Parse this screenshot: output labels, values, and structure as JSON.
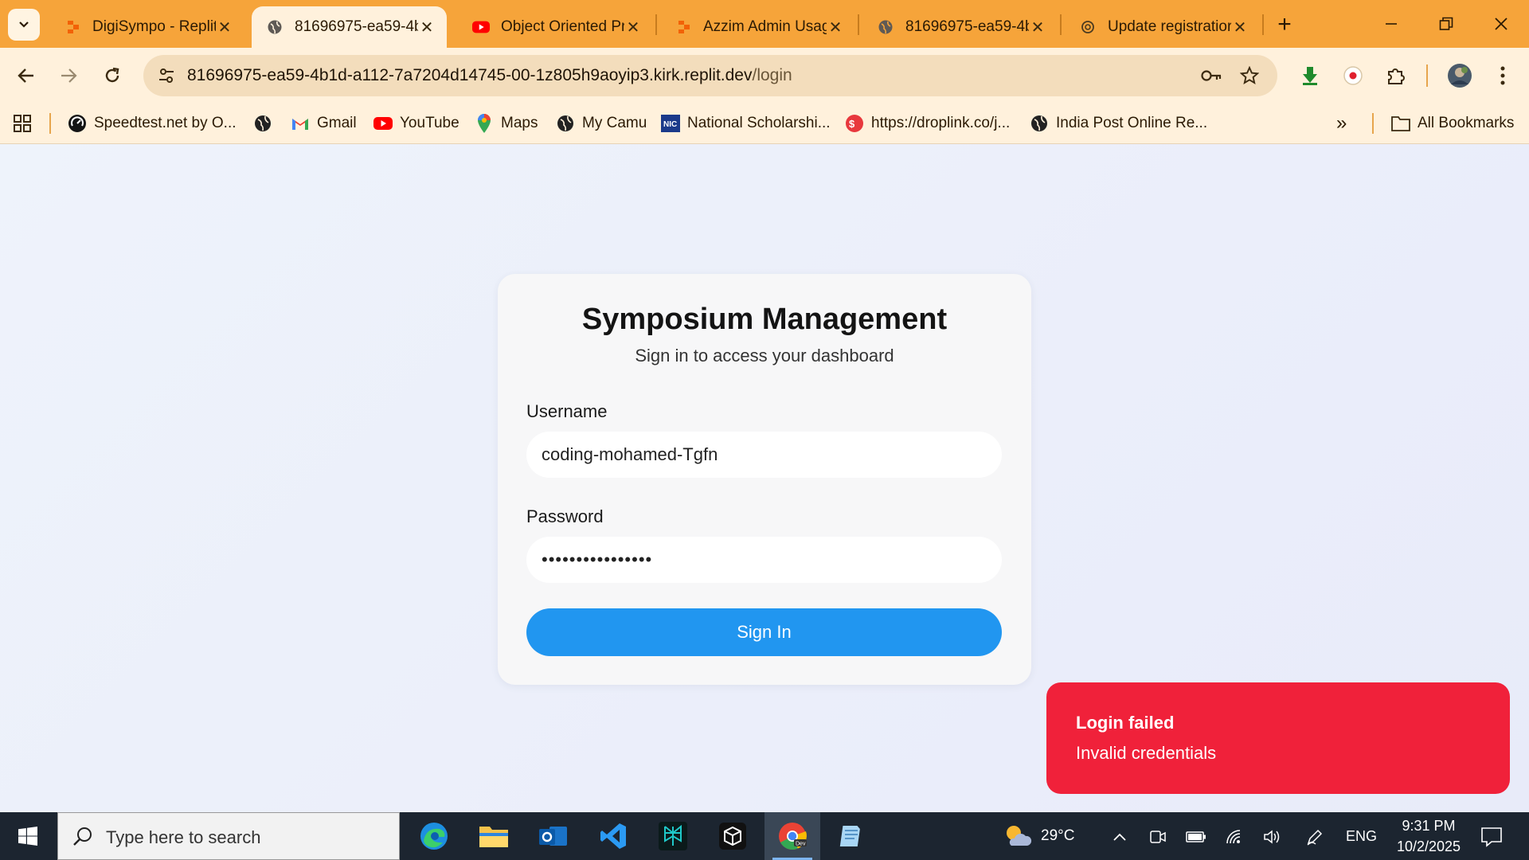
{
  "tabs": [
    {
      "title": "DigiSympo - Replit",
      "favicon": "replit-icon",
      "active": false
    },
    {
      "title": "81696975-ea59-4b",
      "favicon": "globe-icon",
      "active": true
    },
    {
      "title": "Object Oriented Pr",
      "favicon": "youtube-icon",
      "active": false
    },
    {
      "title": "Azzim Admin Usag",
      "favicon": "replit-icon",
      "active": false
    },
    {
      "title": "81696975-ea59-4b",
      "favicon": "globe-icon",
      "active": false
    },
    {
      "title": "Update registratior",
      "favicon": "chatgpt-icon",
      "active": false
    }
  ],
  "address_bar": {
    "host": "81696975-ea59-4b1d-a112-7a7204d14745-00-1z805h9aoyip3.kirk.replit.dev",
    "path": "/login"
  },
  "bookmarks": {
    "items": [
      {
        "label": "Speedtest.net by O...",
        "icon": "speedtest-icon"
      },
      {
        "label": "",
        "icon": "globe-icon"
      },
      {
        "label": "Gmail",
        "icon": "gmail-icon"
      },
      {
        "label": "YouTube",
        "icon": "youtube-icon"
      },
      {
        "label": "Maps",
        "icon": "maps-icon"
      },
      {
        "label": "My Camu",
        "icon": "globe-icon"
      },
      {
        "label": "National Scholarshi...",
        "icon": "nic-icon"
      },
      {
        "label": "https://droplink.co/j...",
        "icon": "droplink-icon"
      },
      {
        "label": "India Post Online Re...",
        "icon": "globe-icon"
      }
    ],
    "overflow": "»",
    "all_bookmarks": "All Bookmarks"
  },
  "login": {
    "title": "Symposium Management",
    "subtitle": "Sign in to access your dashboard",
    "username_label": "Username",
    "username_value": "coding-mohamed-Tgfn",
    "password_label": "Password",
    "password_value": "••••••••••••••••",
    "submit_label": "Sign In"
  },
  "toast": {
    "title": "Login failed",
    "message": "Invalid credentials",
    "color": "#f0213a"
  },
  "taskbar": {
    "search_placeholder": "Type here to search",
    "weather": "29°C",
    "language": "ENG",
    "time": "9:31 PM",
    "date": "10/2/2025"
  },
  "colors": {
    "tabstrip": "#f6a43a",
    "toolbar": "#fff1dc",
    "primary_button": "#2196f0"
  }
}
